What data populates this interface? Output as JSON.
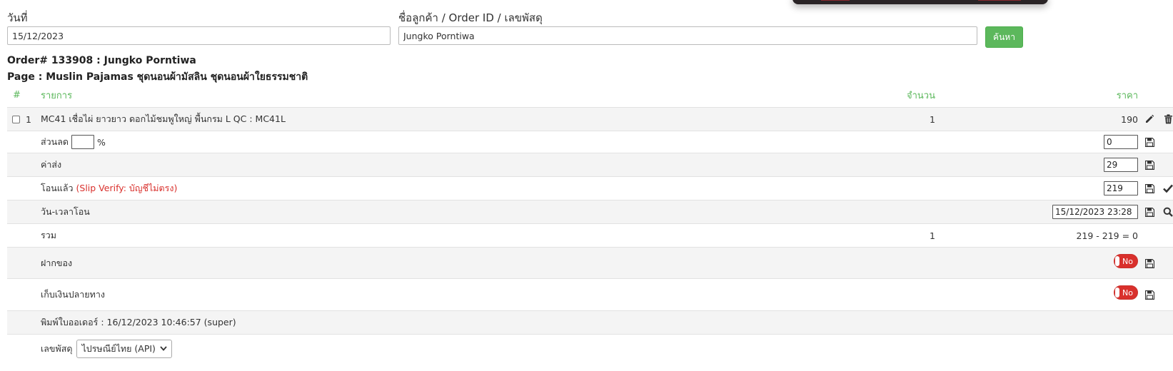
{
  "search": {
    "date_label": "วันที่",
    "date_value": "15/12/2023",
    "query_label": "ชื่อลูกค้า / Order ID / เลขพัสดุ",
    "query_value": "Jungko Porntiwa",
    "button_label": "ค้นหา"
  },
  "order": {
    "title": "Order# 133908 : Jungko Porntiwa",
    "page": "Page : Muslin Pajamas ชุดนอนผ้ามัสลิน ชุดนอนผ้าใยธรรมชาติ"
  },
  "table": {
    "headers": {
      "num": "#",
      "item": "รายการ",
      "qty": "จำนวน",
      "price": "ราคา"
    },
    "item": {
      "num": "1",
      "name": "MC41 เชื่อไผ่ ยาวยาว ดอกไม้ชมพูใหญ่ พื้นกรม L QC : MC41L",
      "qty": "1",
      "price": "190"
    },
    "discount": {
      "label": "ส่วนลด",
      "percent_value": "",
      "percent_sign": "%",
      "amount": "0"
    },
    "shipping": {
      "label": "ค่าส่ง",
      "amount": "29"
    },
    "transfer": {
      "label": "โอนแล้ว",
      "note": "(Slip Verify: บัญชีไม่ตรง)",
      "amount": "219"
    },
    "transfer_time": {
      "label": "วัน-เวลาโอน",
      "value": "15/12/2023 23:28"
    },
    "total": {
      "label": "รวม",
      "qty": "1",
      "calc": "219 - 219 = 0"
    },
    "deposit": {
      "label": "ฝากของ",
      "toggle": "No"
    },
    "cod": {
      "label": "เก็บเงินปลายทาง",
      "toggle": "No"
    },
    "printed": {
      "text": "พิมพ์ใบออเดอร์ : 16/12/2023 10:46:57 (super)"
    },
    "tracking": {
      "label": "เลขพัสดุ",
      "carrier": "ไปรษณีย์ไทย (API)"
    }
  },
  "colors": {
    "accent_green": "#5cb85c",
    "danger_red": "#d9302c",
    "row_alt": "#f4f4f4"
  },
  "icons": [
    "pencil-icon",
    "trash-icon",
    "save-icon",
    "check-icon",
    "search-icon",
    "chevron-down-icon"
  ]
}
